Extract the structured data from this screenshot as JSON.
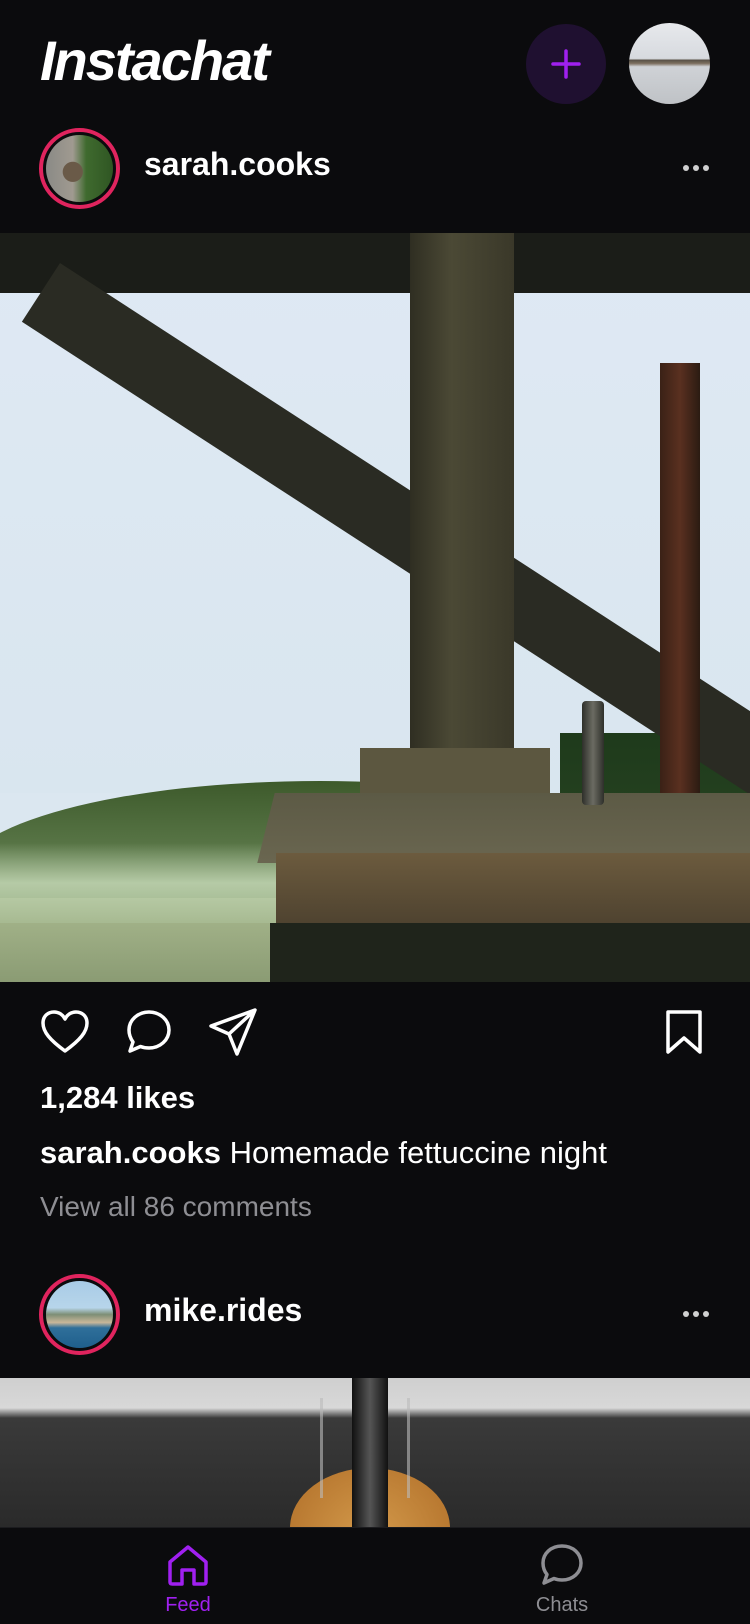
{
  "app": {
    "title": "Instachat"
  },
  "header": {
    "new_post_icon": "plus-icon",
    "profile_avatar": "profile-avatar"
  },
  "colors": {
    "accent": "#a020f0",
    "story_ring": "#e0245e",
    "background": "#0b0b0d",
    "muted": "#8e8e93"
  },
  "posts": [
    {
      "username": "sarah.cooks",
      "likes": "1,284 likes",
      "caption_user": "sarah.cooks",
      "caption_text": "Homemade fettuccine night",
      "comments_link": "View all 86 comments"
    },
    {
      "username": "mike.rides"
    }
  ],
  "bottom_nav": {
    "items": [
      {
        "label": "Feed",
        "icon": "home-icon",
        "active": true
      },
      {
        "label": "Chats",
        "icon": "chat-bubble-icon",
        "active": false
      }
    ]
  }
}
